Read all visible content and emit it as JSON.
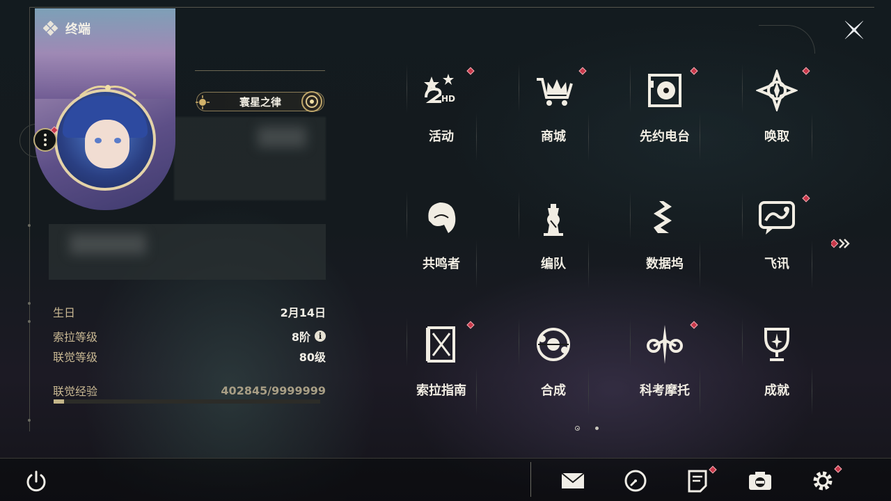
{
  "header": {
    "title": "终端"
  },
  "profile": {
    "name": "寰星之律",
    "stats": [
      {
        "label": "生日",
        "value": "2月14日"
      },
      {
        "label": "索拉等级",
        "value": "8阶"
      },
      {
        "label": "联觉等级",
        "value": "80级"
      }
    ],
    "exp_label": "联觉经验",
    "exp_value": "402845/9999999",
    "exp_progress": 0.04
  },
  "grid": [
    {
      "label": "活动",
      "icon": "event-2hd-icon",
      "badge": true
    },
    {
      "label": "商城",
      "icon": "shop-crown-cart-icon",
      "badge": true
    },
    {
      "label": "先约电台",
      "icon": "radio-turntable-icon",
      "badge": true
    },
    {
      "label": "唤取",
      "icon": "summon-compass-icon",
      "badge": true
    },
    {
      "label": "共鸣者",
      "icon": "resonator-head-icon",
      "badge": false
    },
    {
      "label": "编队",
      "icon": "team-chess-icon",
      "badge": false
    },
    {
      "label": "数据坞",
      "icon": "data-dock-icon",
      "badge": false
    },
    {
      "label": "飞讯",
      "icon": "chat-message-icon",
      "badge": true
    },
    {
      "label": "索拉指南",
      "icon": "guide-book-icon",
      "badge": true
    },
    {
      "label": "合成",
      "icon": "synthesis-orbit-icon",
      "badge": false
    },
    {
      "label": "科考摩托",
      "icon": "motorbike-icon",
      "badge": true
    },
    {
      "label": "成就",
      "icon": "trophy-icon",
      "badge": false
    }
  ],
  "bottom_bar": {
    "items": [
      "mail-icon",
      "clock-icon",
      "notes-icon",
      "camera-icon",
      "settings-gear-icon"
    ]
  },
  "colors": {
    "accent_gold": "#c5b689",
    "badge_red": "#c8384a",
    "text": "#f1ede3"
  }
}
